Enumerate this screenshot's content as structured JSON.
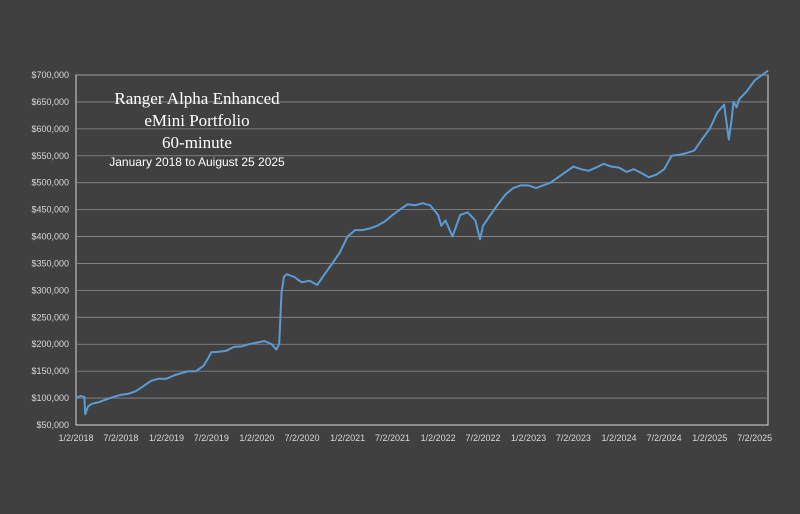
{
  "chart_data": {
    "type": "line",
    "title_lines": [
      "Ranger Alpha Enhanced",
      "eMini Portfolio",
      "60-minute"
    ],
    "subtitle": "January 2018 to Auigust 25 2025",
    "xlabel": "",
    "ylabel": "",
    "ylim": [
      50000,
      700000
    ],
    "grid": true,
    "y_ticks": [
      "$50,000",
      "$100,000",
      "$150,000",
      "$200,000",
      "$250,000",
      "$300,000",
      "$350,000",
      "$400,000",
      "$450,000",
      "$500,000",
      "$550,000",
      "$600,000",
      "$650,000",
      "$700,000"
    ],
    "x_ticks": [
      "1/2/2018",
      "7/2/2018",
      "1/2/2019",
      "7/2/2019",
      "1/2/2020",
      "7/2/2020",
      "1/2/2021",
      "7/2/2021",
      "1/2/2022",
      "7/2/2022",
      "1/2/2023",
      "7/2/2023",
      "1/2/2024",
      "7/2/2024",
      "1/2/2025",
      "7/2/2025"
    ],
    "colors": {
      "line": "#5b9bd5",
      "background": "#404040",
      "grid": "#8c8c8c",
      "text": "#d9d9d9"
    },
    "series": [
      {
        "x": [
          "2018-01-02",
          "2018-01-20",
          "2018-02-05",
          "2018-02-08",
          "2018-02-20",
          "2018-03-10",
          "2018-04-01",
          "2018-05-01",
          "2018-06-01",
          "2018-07-02",
          "2018-08-01",
          "2018-09-01",
          "2018-10-01",
          "2018-11-01",
          "2018-12-01",
          "2019-01-02",
          "2019-02-01",
          "2019-03-01",
          "2019-04-01",
          "2019-05-01",
          "2019-06-01",
          "2019-06-20",
          "2019-07-02",
          "2019-08-01",
          "2019-09-01",
          "2019-10-01",
          "2019-11-01",
          "2019-12-01",
          "2020-01-02",
          "2020-02-01",
          "2020-03-01",
          "2020-03-20",
          "2020-04-01",
          "2020-04-10",
          "2020-04-20",
          "2020-05-01",
          "2020-06-01",
          "2020-06-15",
          "2020-07-02",
          "2020-08-01",
          "2020-09-01",
          "2020-10-01",
          "2020-11-01",
          "2020-12-01",
          "2021-01-02",
          "2021-02-01",
          "2021-03-01",
          "2021-04-01",
          "2021-05-01",
          "2021-06-01",
          "2021-07-02",
          "2021-08-01",
          "2021-09-01",
          "2021-10-01",
          "2021-11-01",
          "2021-12-01",
          "2022-01-02",
          "2022-01-15",
          "2022-02-01",
          "2022-03-01",
          "2022-04-01",
          "2022-05-01",
          "2022-06-01",
          "2022-06-20",
          "2022-07-02",
          "2022-08-01",
          "2022-09-01",
          "2022-10-01",
          "2022-11-01",
          "2022-12-01",
          "2023-01-02",
          "2023-02-01",
          "2023-03-01",
          "2023-04-01",
          "2023-05-01",
          "2023-06-01",
          "2023-07-02",
          "2023-08-01",
          "2023-09-01",
          "2023-10-01",
          "2023-11-01",
          "2023-12-01",
          "2024-01-02",
          "2024-02-01",
          "2024-03-01",
          "2024-04-01",
          "2024-05-01",
          "2024-06-01",
          "2024-07-02",
          "2024-08-01",
          "2024-09-01",
          "2024-10-01",
          "2024-11-01",
          "2024-12-01",
          "2025-01-02",
          "2025-02-01",
          "2025-03-01",
          "2025-03-20",
          "2025-04-01",
          "2025-04-08",
          "2025-04-20",
          "2025-05-01",
          "2025-06-01",
          "2025-07-02",
          "2025-08-01",
          "2025-08-25"
        ],
        "values": [
          100000,
          104000,
          102000,
          70000,
          85000,
          90000,
          92000,
          97000,
          102000,
          106000,
          108000,
          113000,
          122000,
          132000,
          136000,
          136000,
          142000,
          146000,
          150000,
          150000,
          160000,
          175000,
          185000,
          186000,
          188000,
          195000,
          196000,
          200000,
          203000,
          206000,
          200000,
          190000,
          200000,
          295000,
          325000,
          330000,
          325000,
          320000,
          315000,
          318000,
          310000,
          330000,
          350000,
          370000,
          400000,
          412000,
          412000,
          415000,
          420000,
          428000,
          440000,
          450000,
          460000,
          458000,
          462000,
          458000,
          440000,
          420000,
          430000,
          400000,
          440000,
          445000,
          430000,
          395000,
          420000,
          440000,
          460000,
          478000,
          490000,
          495000,
          495000,
          490000,
          495000,
          500000,
          510000,
          520000,
          530000,
          525000,
          522000,
          528000,
          535000,
          530000,
          528000,
          520000,
          525000,
          518000,
          510000,
          515000,
          525000,
          550000,
          552000,
          555000,
          560000,
          580000,
          600000,
          630000,
          645000,
          580000,
          620000,
          650000,
          640000,
          655000,
          670000,
          690000,
          700000,
          708000
        ]
      }
    ]
  }
}
